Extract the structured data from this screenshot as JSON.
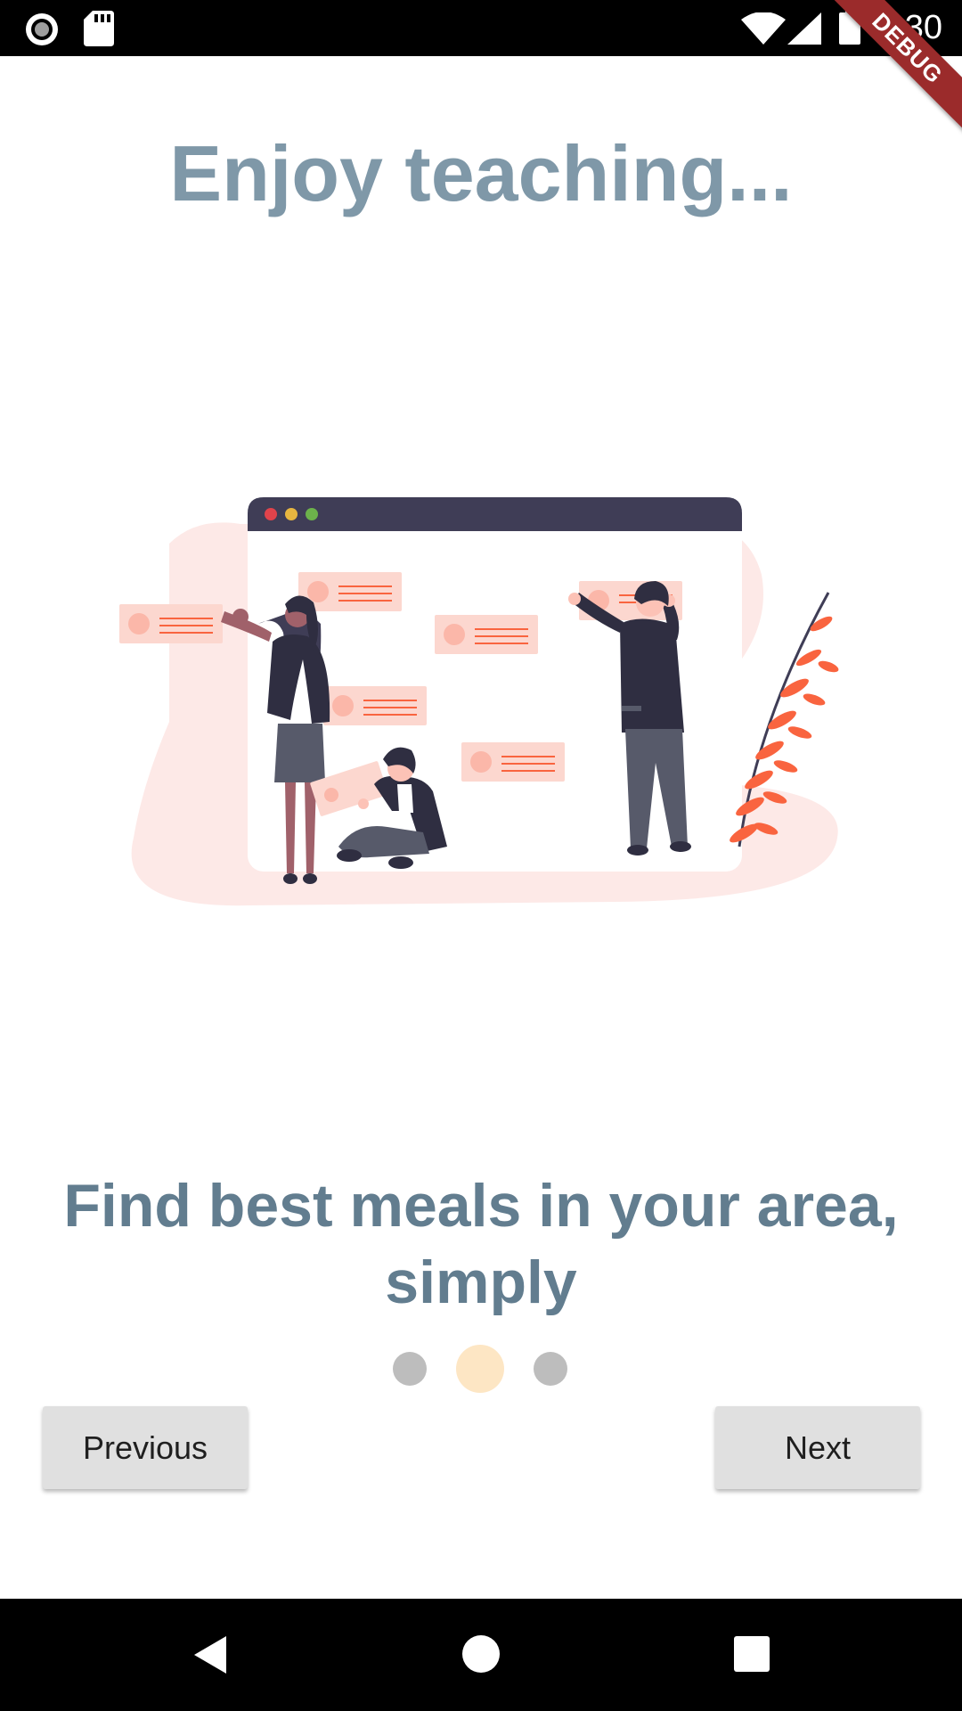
{
  "status_bar": {
    "time": "8:30",
    "icons": [
      "record-icon",
      "sd-card-icon",
      "wifi-icon",
      "cell-signal-icon",
      "battery-icon"
    ]
  },
  "debug_banner": {
    "label": "DEBUG",
    "color": "#9b2b2b"
  },
  "onboarding": {
    "title": "Enjoy teaching...",
    "subtitle": "Find best meals in your area, simply",
    "page_indicator": {
      "count": 3,
      "active_index": 1
    },
    "previous_label": "Previous",
    "next_label": "Next"
  },
  "nav_bar": {
    "icons": [
      "back-icon",
      "home-icon",
      "recents-icon"
    ]
  },
  "colors": {
    "title": "#7f98a8",
    "subtitle": "#627d8f",
    "dot_inactive": "#bdbdbd",
    "dot_active": "#fde6c4",
    "button_bg": "#e0e0e0",
    "illustration_accent": "#f9643f",
    "illustration_blob": "#fde9e7",
    "illustration_dark": "#3f3d56"
  }
}
